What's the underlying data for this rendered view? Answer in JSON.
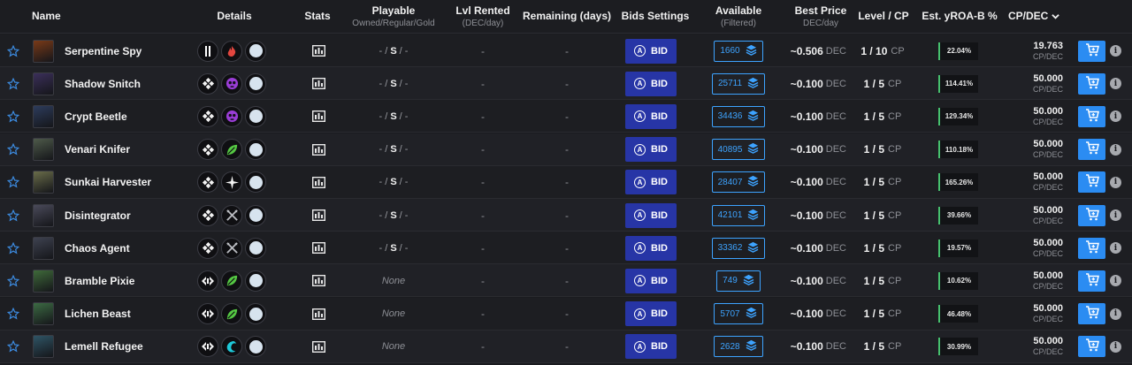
{
  "columns": {
    "name": "Name",
    "details": "Details",
    "stats": "Stats",
    "playable": "Playable",
    "playable_sub": "Owned/Regular/Gold",
    "lvl_rented": "Lvl Rented",
    "lvl_rented_sub": "(DEC/day)",
    "remaining": "Remaining (days)",
    "bids_settings": "Bids Settings",
    "available": "Available",
    "available_sub": "(Filtered)",
    "best_price": "Best Price",
    "best_price_sub": "DEC/day",
    "level_cp": "Level / CP",
    "yroa": "Est. yROA-B %",
    "cpdec": "CP/DEC",
    "sort_icon": "chevron-down-icon"
  },
  "labels": {
    "bid": "BID",
    "dash": "-",
    "dec_unit": "DEC",
    "cp_unit": "CP",
    "cpdec_unit": "CP/DEC",
    "info": "i",
    "bid_icon_letter": "A"
  },
  "colors": {
    "bid_button": "#2735a6",
    "cart_button": "#2b8cf2",
    "available_border": "#3da3ff",
    "yroa_bar": "#46c06e"
  },
  "rows": [
    {
      "name": "Serpentine Spy",
      "icons": [
        "tall-bar-icon",
        "fire-icon",
        "neutral-dot-icon"
      ],
      "playable": {
        "type": "dashes",
        "prefix": "- /",
        "s": "S",
        "suffix": "/ -"
      },
      "lvl_rented": "-",
      "remaining": "-",
      "available": "1660",
      "best_price": "~0.506",
      "level": "1 / 10",
      "yroa": "22.04%",
      "cpdec": "19.763",
      "thumb": "#7a3a18"
    },
    {
      "name": "Shadow Snitch",
      "icons": [
        "diamond-cross-icon",
        "death-skull-icon",
        "neutral-dot-icon"
      ],
      "playable": {
        "type": "dashes",
        "prefix": "- /",
        "s": "S",
        "suffix": "/ -"
      },
      "lvl_rented": "-",
      "remaining": "-",
      "available": "25711",
      "best_price": "~0.100",
      "level": "1 / 5",
      "yroa": "114.41%",
      "cpdec": "50.000",
      "thumb": "#3b2f5a"
    },
    {
      "name": "Crypt Beetle",
      "icons": [
        "diamond-cross-icon",
        "death-skull-icon",
        "neutral-dot-icon"
      ],
      "playable": {
        "type": "dashes",
        "prefix": "- /",
        "s": "S",
        "suffix": "/ -"
      },
      "lvl_rented": "-",
      "remaining": "-",
      "available": "34436",
      "best_price": "~0.100",
      "level": "1 / 5",
      "yroa": "129.34%",
      "cpdec": "50.000",
      "thumb": "#2d3c5c"
    },
    {
      "name": "Venari Knifer",
      "icons": [
        "diamond-cross-icon",
        "earth-leaf-icon",
        "neutral-dot-icon"
      ],
      "playable": {
        "type": "dashes",
        "prefix": "- /",
        "s": "S",
        "suffix": "/ -"
      },
      "lvl_rented": "-",
      "remaining": "-",
      "available": "40895",
      "best_price": "~0.100",
      "level": "1 / 5",
      "yroa": "110.18%",
      "cpdec": "50.000",
      "thumb": "#4e5a4a"
    },
    {
      "name": "Sunkai Harvester",
      "icons": [
        "diamond-cross-icon",
        "life-star-icon",
        "neutral-dot-icon"
      ],
      "playable": {
        "type": "dashes",
        "prefix": "- /",
        "s": "S",
        "suffix": "/ -"
      },
      "lvl_rented": "-",
      "remaining": "-",
      "available": "28407",
      "best_price": "~0.100",
      "level": "1 / 5",
      "yroa": "165.26%",
      "cpdec": "50.000",
      "thumb": "#6a6d4a"
    },
    {
      "name": "Disintegrator",
      "icons": [
        "diamond-cross-icon",
        "crossed-swords-icon",
        "neutral-dot-icon"
      ],
      "playable": {
        "type": "dashes",
        "prefix": "- /",
        "s": "S",
        "suffix": "/ -"
      },
      "lvl_rented": "-",
      "remaining": "-",
      "available": "42101",
      "best_price": "~0.100",
      "level": "1 / 5",
      "yroa": "39.66%",
      "cpdec": "50.000",
      "thumb": "#4a4a5a"
    },
    {
      "name": "Chaos Agent",
      "icons": [
        "diamond-cross-icon",
        "crossed-swords-icon",
        "neutral-dot-icon"
      ],
      "playable": {
        "type": "dashes",
        "prefix": "- /",
        "s": "S",
        "suffix": "/ -"
      },
      "lvl_rented": "-",
      "remaining": "-",
      "available": "33362",
      "best_price": "~0.100",
      "level": "1 / 5",
      "yroa": "19.57%",
      "cpdec": "50.000",
      "thumb": "#3e4250"
    },
    {
      "name": "Bramble Pixie",
      "icons": [
        "double-chevron-icon",
        "earth-leaf-icon",
        "neutral-dot-icon"
      ],
      "playable": {
        "type": "none",
        "text": "None"
      },
      "lvl_rented": "-",
      "remaining": "-",
      "available": "749",
      "best_price": "~0.100",
      "level": "1 / 5",
      "yroa": "10.62%",
      "cpdec": "50.000",
      "thumb": "#3f6a3a"
    },
    {
      "name": "Lichen Beast",
      "icons": [
        "double-chevron-icon",
        "earth-leaf-icon",
        "neutral-dot-icon"
      ],
      "playable": {
        "type": "none",
        "text": "None"
      },
      "lvl_rented": "-",
      "remaining": "-",
      "available": "5707",
      "best_price": "~0.100",
      "level": "1 / 5",
      "yroa": "46.48%",
      "cpdec": "50.000",
      "thumb": "#3c6b43"
    },
    {
      "name": "Lemell Refugee",
      "icons": [
        "double-chevron-icon",
        "water-drop-icon",
        "neutral-dot-icon"
      ],
      "playable": {
        "type": "none",
        "text": "None"
      },
      "lvl_rented": "-",
      "remaining": "-",
      "available": "2628",
      "best_price": "~0.100",
      "level": "1 / 5",
      "yroa": "30.99%",
      "cpdec": "50.000",
      "thumb": "#2f5566"
    }
  ]
}
